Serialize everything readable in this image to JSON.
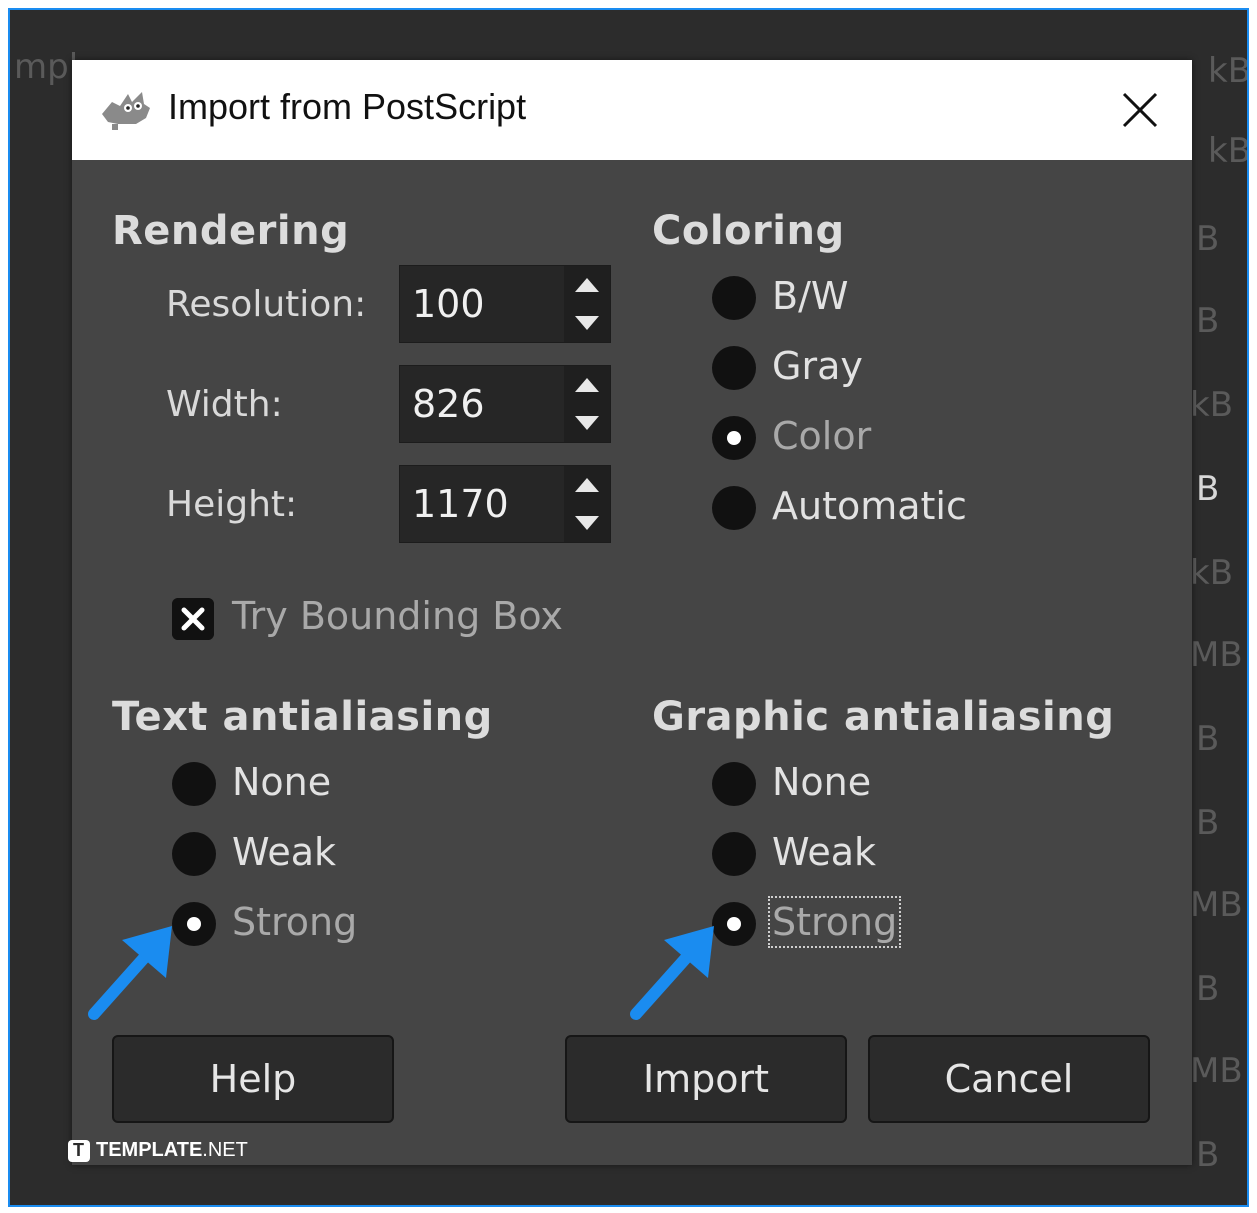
{
  "background_fragments": [
    "mpl",
    "kB",
    "kB",
    "B",
    "B",
    "kB",
    "B",
    "kB",
    "MB",
    "B",
    "B",
    "MB",
    "B",
    "MB",
    "B"
  ],
  "dialog": {
    "title": "Import from PostScript",
    "title_icon": "gimp-wilber-icon",
    "close_icon": "close-icon"
  },
  "rendering": {
    "title": "Rendering",
    "fields": [
      {
        "label": "Resolution:",
        "value": "100"
      },
      {
        "label": "Width:",
        "value": "826"
      },
      {
        "label": "Height:",
        "value": "1170"
      }
    ],
    "try_bounding_box": {
      "label": "Try Bounding Box",
      "checked": true
    }
  },
  "coloring": {
    "title": "Coloring",
    "options": [
      {
        "label": "B/W",
        "checked": false
      },
      {
        "label": "Gray",
        "checked": false
      },
      {
        "label": "Color",
        "checked": true
      },
      {
        "label": "Automatic",
        "checked": false
      }
    ]
  },
  "text_antialiasing": {
    "title": "Text antialiasing",
    "options": [
      {
        "label": "None",
        "checked": false
      },
      {
        "label": "Weak",
        "checked": false
      },
      {
        "label": "Strong",
        "checked": true
      }
    ]
  },
  "graphic_antialiasing": {
    "title": "Graphic antialiasing",
    "options": [
      {
        "label": "None",
        "checked": false
      },
      {
        "label": "Weak",
        "checked": false
      },
      {
        "label": "Strong",
        "checked": true
      }
    ]
  },
  "buttons": {
    "help": "Help",
    "import": "Import",
    "cancel": "Cancel"
  },
  "watermark": {
    "brand": "TEMPLATE",
    "suffix": ".NET"
  },
  "colors": {
    "accent_arrow": "#1a8cf0",
    "dialog_bg": "#454545",
    "titlebar_bg": "#ffffff"
  }
}
